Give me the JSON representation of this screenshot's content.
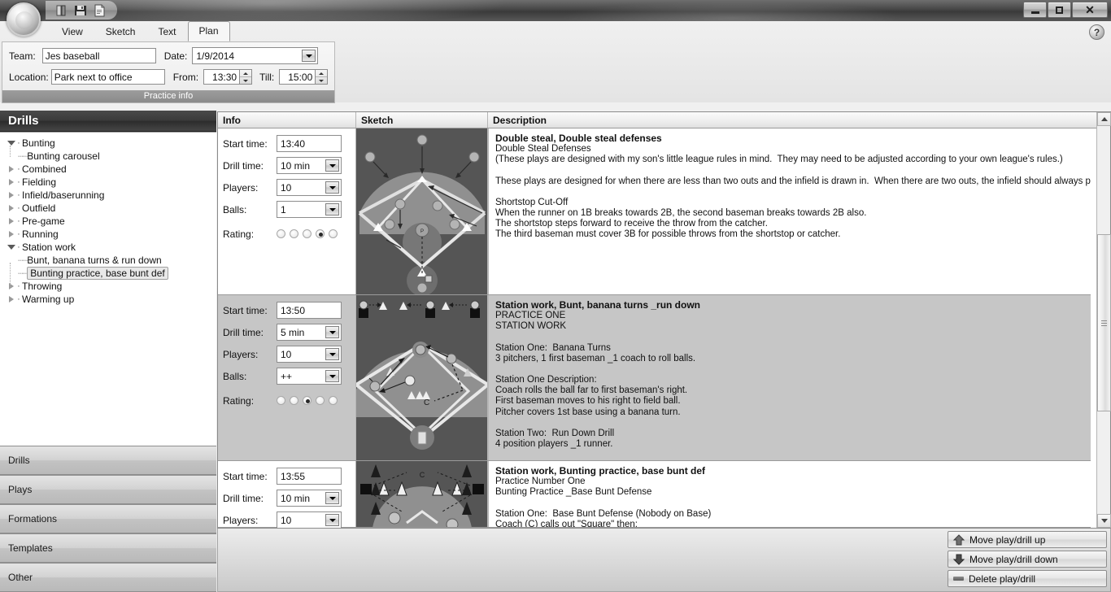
{
  "window": {
    "minimize_label": "Minimize",
    "maximize_label": "Maximize",
    "close_label": "Close",
    "help_label": "?"
  },
  "quick_access": {
    "items": [
      {
        "name": "open-icon",
        "label": "Open"
      },
      {
        "name": "save-icon",
        "label": "Save"
      },
      {
        "name": "new-document-icon",
        "label": "New"
      }
    ]
  },
  "ribbon": {
    "tabs": [
      {
        "label": "View",
        "active": false
      },
      {
        "label": "Sketch",
        "active": false
      },
      {
        "label": "Text",
        "active": false
      },
      {
        "label": "Plan",
        "active": true
      }
    ]
  },
  "practice_info": {
    "caption": "Practice info",
    "team_label": "Team:",
    "team_value": "Jes baseball",
    "location_label": "Location:",
    "location_value": "Park next to office",
    "date_label": "Date:",
    "date_value": "1/9/2014",
    "from_label": "From:",
    "from_value": "13:30",
    "till_label": "Till:",
    "till_value": "15:00"
  },
  "sidebar": {
    "title": "Drills",
    "tree": [
      {
        "label": "Bunting",
        "level": 0,
        "state": "expanded"
      },
      {
        "label": "Bunting carousel",
        "level": 1,
        "state": "leaf"
      },
      {
        "label": "Combined",
        "level": 0,
        "state": "collapsed"
      },
      {
        "label": "Fielding",
        "level": 0,
        "state": "collapsed"
      },
      {
        "label": "Infield/baserunning",
        "level": 0,
        "state": "collapsed"
      },
      {
        "label": "Outfield",
        "level": 0,
        "state": "collapsed"
      },
      {
        "label": "Pre-game",
        "level": 0,
        "state": "collapsed"
      },
      {
        "label": "Running",
        "level": 0,
        "state": "collapsed"
      },
      {
        "label": "Station work",
        "level": 0,
        "state": "expanded"
      },
      {
        "label": "Bunt, banana turns & run down",
        "level": 1,
        "state": "leaf"
      },
      {
        "label": "Bunting practice, base bunt def",
        "level": 1,
        "state": "leaf",
        "selected": true
      },
      {
        "label": "Throwing",
        "level": 0,
        "state": "collapsed"
      },
      {
        "label": "Warming up",
        "level": 0,
        "state": "collapsed"
      }
    ],
    "category_buttons": [
      {
        "label": "Drills"
      },
      {
        "label": "Plays"
      },
      {
        "label": "Formations"
      },
      {
        "label": "Templates"
      },
      {
        "label": "Other"
      }
    ]
  },
  "grid": {
    "columns": [
      "Info",
      "Sketch",
      "Description"
    ],
    "labels": {
      "start_time": "Start time:",
      "drill_time": "Drill time:",
      "players": "Players:",
      "balls": "Balls:",
      "rating": "Rating:"
    },
    "rows": [
      {
        "start_time": "13:40",
        "drill_time": "10 min",
        "players": "10",
        "balls": "1",
        "rating": 4,
        "rating_max": 5,
        "sketch_name": "baseball-diamond-double-steal",
        "title": "Double steal, Double steal defenses",
        "lines": [
          "Double Steal Defenses",
          "(These plays are designed with my son's little league rules in mind.  They may need to be adjusted according to your own league's rules.)",
          "",
          "These plays are designed for when there are less than two outs and the infield is drawn in.  When there are two outs, the infield should always play back.",
          "",
          "Shortstop Cut-Off",
          "When the runner on 1B breaks towards 2B, the second baseman breaks towards 2B also.",
          "The shortstop steps forward to receive the throw from the catcher.",
          "The third baseman must cover 3B for possible throws from the shortstop or catcher."
        ]
      },
      {
        "start_time": "13:50",
        "drill_time": "5 min",
        "players": "10",
        "balls": "++",
        "rating": 3,
        "rating_max": 5,
        "sketch_name": "baseball-diamond-station-work",
        "title": "Station work, Bunt, banana turns _run down",
        "lines": [
          "PRACTICE ONE",
          "STATION WORK",
          "",
          "Station One:  Banana Turns",
          "3 pitchers, 1 first baseman _1 coach to roll balls.",
          "",
          "Station One Description:",
          "Coach rolls the ball far to first baseman's right.",
          "First baseman moves to his right to field ball.",
          "Pitcher covers 1st base using a banana turn.",
          "",
          "Station Two:  Run Down Drill",
          "4 position players _1 runner."
        ]
      },
      {
        "start_time": "13:55",
        "drill_time": "10 min",
        "players": "10",
        "balls": "",
        "rating": 0,
        "rating_max": 5,
        "sketch_name": "baseball-diamond-bunt-defense",
        "title": "Station work, Bunting practice, base bunt def",
        "lines": [
          "Practice Number One",
          "Bunting Practice _Base Bunt Defense",
          "",
          "Station One:  Base Bunt Defense (Nobody on Base)",
          "Coach (C) calls out \"Square\" then:"
        ]
      }
    ]
  },
  "footer": {
    "buttons": [
      {
        "label": "Move play/drill up",
        "icon": "arrow-up-icon"
      },
      {
        "label": "Move play/drill down",
        "icon": "arrow-down-icon"
      },
      {
        "label": "Delete play/drill",
        "icon": "minus-icon"
      }
    ]
  },
  "colors": {
    "titlebar": "#4a4a4a",
    "panel_header": "#3b3b3b",
    "field_green": "#555555",
    "field_grass": "#909090",
    "selected_row": "#c6c6c6"
  }
}
